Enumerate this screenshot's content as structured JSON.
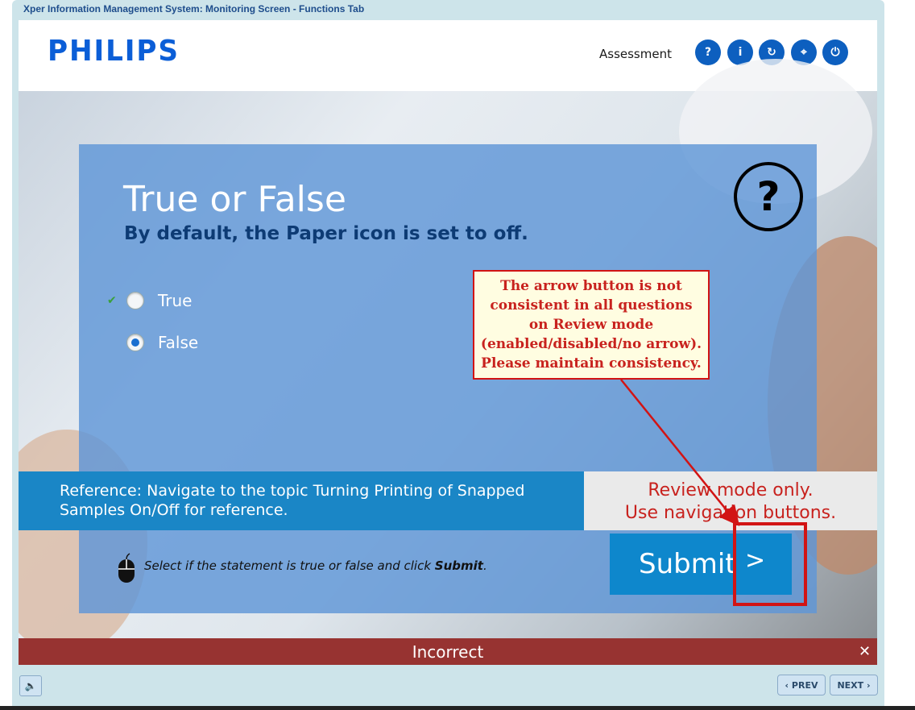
{
  "window": {
    "title": "Xper Information Management System: Monitoring Screen - Functions Tab"
  },
  "header": {
    "logo": "PHILIPS",
    "section": "Assessment",
    "buttons": [
      {
        "icon": "help-icon",
        "glyph": "?"
      },
      {
        "icon": "info-icon",
        "glyph": "i"
      },
      {
        "icon": "refresh-icon",
        "glyph": "↻"
      },
      {
        "icon": "compass-icon",
        "glyph": "⌖"
      },
      {
        "icon": "power-icon",
        "glyph": "⏻"
      }
    ]
  },
  "question": {
    "title": "True or False",
    "statement": "By default, the Paper icon is set to off.",
    "options": [
      {
        "label": "True",
        "selected": false,
        "correct_mark": true
      },
      {
        "label": "False",
        "selected": true
      }
    ],
    "help_glyph": "?"
  },
  "reference": {
    "text": "Reference: Navigate to the topic Turning Printing of Snapped Samples On/Off for reference."
  },
  "review": {
    "line1": "Review mode only.",
    "line2": "Use navigation buttons."
  },
  "instruction": {
    "prefix": "Select if the statement is true or false and click ",
    "action": "Submit",
    "suffix": "."
  },
  "submit": {
    "label": "Submit",
    "arrow": ">"
  },
  "annotation": {
    "text": "The arrow button is not consistent in all questions on Review mode (enabled/disabled/no arrow). Please maintain consistency."
  },
  "feedback": {
    "text": "Incorrect",
    "close": "✕"
  },
  "footer": {
    "prev": "PREV",
    "next": "NEXT",
    "prev_glyph": "‹",
    "next_glyph": "›"
  },
  "colors": {
    "accent": "#0d5fbf",
    "feedback": "#973331",
    "reference": "#1a86c6",
    "annotation": "#c8221e"
  }
}
